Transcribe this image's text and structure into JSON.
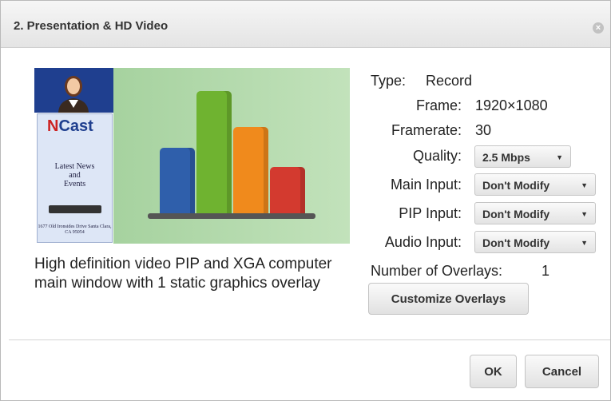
{
  "dialog": {
    "title": "2. Presentation & HD Video"
  },
  "preview": {
    "logo_letter": "N",
    "logo_text": "Cast",
    "side_text_line1": "Latest News",
    "side_text_line2": "and",
    "side_text_line3": "Events",
    "address": "1677 Old Ironsides Drive Santa Clara, CA 95054",
    "bars": [
      {
        "color": "#2f5fab",
        "value": 0.52
      },
      {
        "color": "#6fb330",
        "value": 0.96
      },
      {
        "color": "#f08a1c",
        "value": 0.68
      },
      {
        "color": "#d33a2f",
        "value": 0.37
      }
    ]
  },
  "description": "High definition video PIP and XGA computer main window with 1 static graphics overlay",
  "settings": {
    "type_label": "Type:",
    "type_value": "Record",
    "frame_label": "Frame:",
    "frame_value": "1920×1080",
    "framerate_label": "Framerate:",
    "framerate_value": "30",
    "quality_label": "Quality:",
    "quality_value": "2.5 Mbps",
    "main_input_label": "Main Input:",
    "main_input_value": "Don't Modify",
    "pip_input_label": "PIP Input:",
    "pip_input_value": "Don't Modify",
    "audio_input_label": "Audio Input:",
    "audio_input_value": "Don't Modify",
    "overlays_label": "Number of Overlays:",
    "overlays_value": "1",
    "customize_label": "Customize Overlays"
  },
  "footer": {
    "ok_label": "OK",
    "cancel_label": "Cancel"
  },
  "icons": {
    "close": "close-icon",
    "caret": "chevron-down-icon"
  }
}
